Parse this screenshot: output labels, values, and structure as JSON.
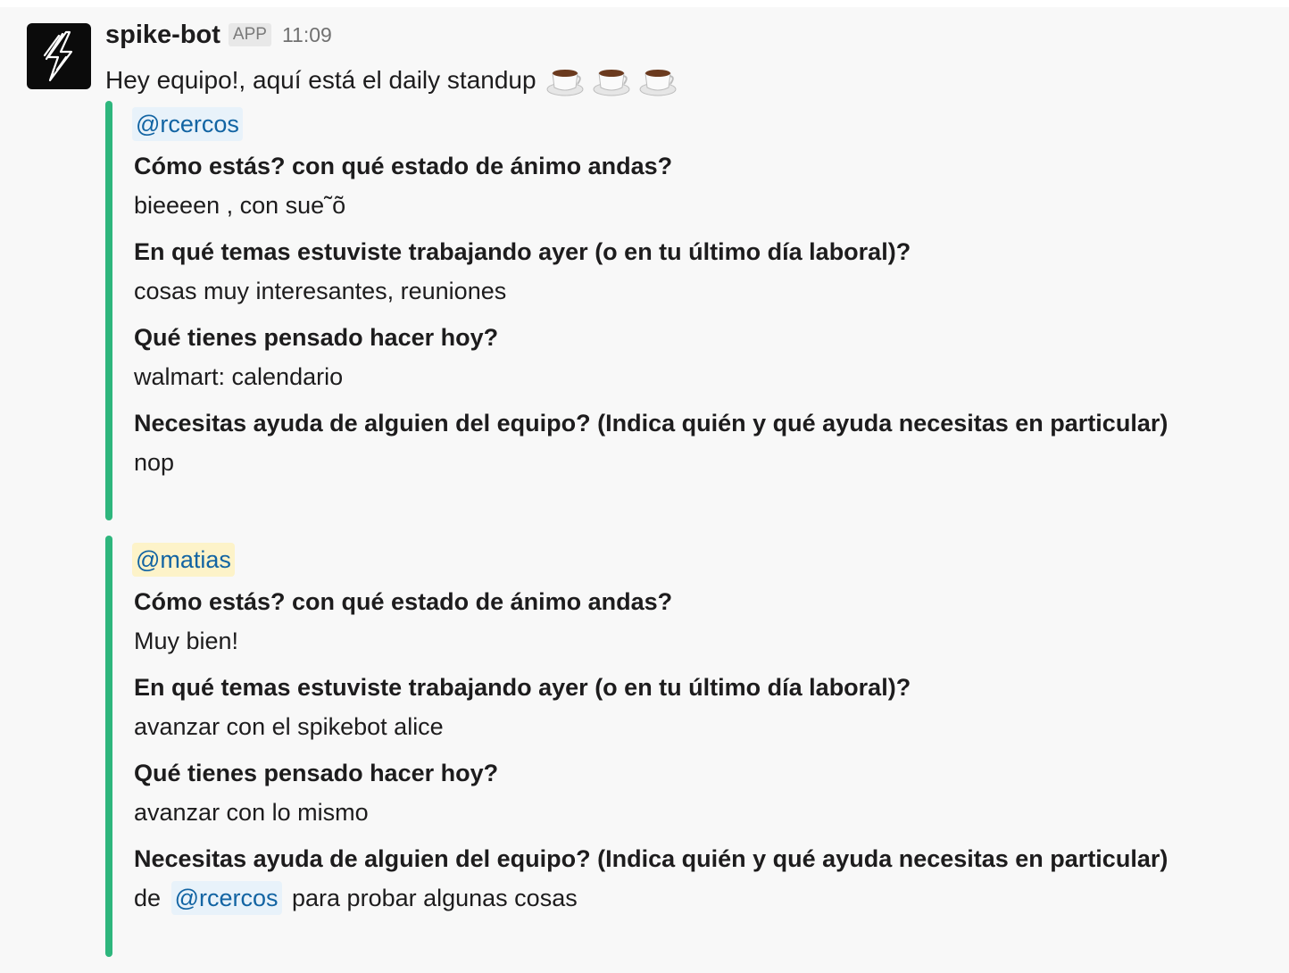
{
  "message": {
    "bot_name": "spike-bot",
    "badge": "APP",
    "time": "11:09",
    "intro_text": "Hey equipo!, aquí está el daily standup",
    "intro_emoji": [
      "coffee-icon",
      "coffee-icon",
      "coffee-icon"
    ],
    "avatar_icon": "lightning-bolt-icon"
  },
  "attachments": [
    {
      "mention": "@rcercos",
      "accent_color": "#2eb67d",
      "qa": [
        {
          "q": "Cómo estás? con qué estado de ánimo andas?",
          "a": "bieeeen , con sue˜õ"
        },
        {
          "q": "En qué temas estuviste trabajando ayer (o en tu último día laboral)?",
          "a": "cosas muy interesantes, reuniones"
        },
        {
          "q": "Qué tienes pensado hacer hoy?",
          "a": "walmart: calendario"
        },
        {
          "q": "Necesitas ayuda de alguien del equipo? (Indica quién y qué ayuda necesitas en particular)",
          "a": "nop"
        }
      ]
    },
    {
      "mention": "@matias",
      "accent_color": "#2eb67d",
      "qa": [
        {
          "q": "Cómo estás? con qué estado de ánimo andas?",
          "a": "Muy bien!"
        },
        {
          "q": "En qué temas estuviste trabajando ayer (o en tu último día laboral)?",
          "a": "avanzar con el spikebot alice"
        },
        {
          "q": "Qué tienes pensado hacer hoy?",
          "a": "avanzar con lo mismo"
        },
        {
          "q": "Necesitas ayuda de alguien del equipo? (Indica quién y qué ayuda necesitas en particular)",
          "a_prefix": "de",
          "a_mention": "@rcercos",
          "a_suffix": "para probar algunas cosas"
        }
      ]
    }
  ]
}
